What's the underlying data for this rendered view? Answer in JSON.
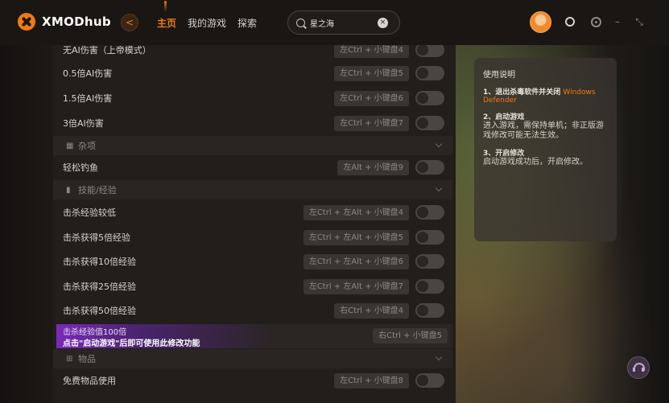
{
  "app": {
    "name": "XMODhub"
  },
  "nav": {
    "back_icon": "<",
    "items": [
      "主页",
      "我的游戏",
      "探索"
    ]
  },
  "search": {
    "value": "星之海",
    "clear_icon": "×"
  },
  "window_controls": {
    "minimize": "–",
    "maximize": "⤡"
  },
  "rows_top": [
    {
      "label": "无AI伤害（上帝模式）",
      "hotkey": "左Ctrl + 小键盘4"
    },
    {
      "label": "0.5倍AI伤害",
      "hotkey": "左Ctrl + 小键盘5"
    },
    {
      "label": "1.5倍AI伤害",
      "hotkey": "左Ctrl + 小键盘6"
    },
    {
      "label": "3倍AI伤害",
      "hotkey": "左Ctrl + 小键盘7"
    }
  ],
  "section_misc": {
    "icon": "▦",
    "label": "杂项"
  },
  "row_fish": {
    "label": "轻松钓鱼",
    "hotkey": "左Alt + 小键盘9"
  },
  "section_skill": {
    "icon": "▮",
    "label": "技能/经验"
  },
  "rows_skill": [
    {
      "label": "击杀经验较低",
      "hotkey": "左Ctrl + 左Alt + 小键盘4"
    },
    {
      "label": "击杀获得5倍经验",
      "hotkey": "左Ctrl + 左Alt + 小键盘5"
    },
    {
      "label": "击杀获得10倍经验",
      "hotkey": "左Ctrl + 左Alt + 小键盘6"
    },
    {
      "label": "击杀获得25倍经验",
      "hotkey": "左Ctrl + 左Alt + 小键盘7"
    },
    {
      "label": "击杀获得50倍经验",
      "hotkey": "右Ctrl + 小键盘4"
    }
  ],
  "tooltip_row": {
    "label": "击杀经验值100倍",
    "tip": "点击\"启动游戏\"后即可使用此修改功能",
    "hotkey": "右Ctrl + 小键盘5"
  },
  "section_items": {
    "icon": "⊞",
    "label": "物品"
  },
  "row_items": {
    "label": "免费物品使用",
    "hotkey": "左Ctrl + 小键盘8"
  },
  "info": {
    "title": "使用说明",
    "step1_title": "1、退出杀毒软件并关闭",
    "step1_highlight": "Windows Defender",
    "step2_title": "2、启动游戏",
    "step2_body": "进入游戏，需保持单机；非正版游戏修改可能无法生效。",
    "step3_title": "3、开启修改",
    "step3_body": "启动游戏成功后，开启修改。"
  },
  "colors": {
    "accent": "#f07a14",
    "tooltip": "#7a2ab9"
  }
}
